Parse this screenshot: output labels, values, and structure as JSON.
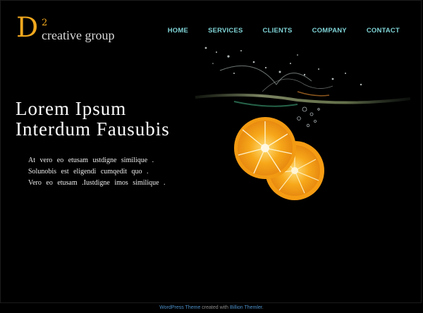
{
  "logo": {
    "letter": "D",
    "superscript": "2",
    "text": "creative group"
  },
  "nav": {
    "items": [
      {
        "label": "HOME"
      },
      {
        "label": "SERVICES"
      },
      {
        "label": "CLIENTS"
      },
      {
        "label": "COMPANY"
      },
      {
        "label": "CONTACT"
      }
    ]
  },
  "hero": {
    "headline_line1": "Lorem Ipsum",
    "headline_line2": "Interdum Fausubis",
    "body_lines": [
      "At vero  eo etusam  ustdigne  similique  .",
      "Solunobis  est eligendi  cumqedit  quo .",
      "Vero  eo etusam  .Iustdigne  imos  similique  ."
    ]
  },
  "footer": {
    "link1": "WordPress Theme",
    "middle": " created with ",
    "link2": "Billion Themler",
    "end": "."
  },
  "colors": {
    "background": "#000000",
    "accent_orange": "#f1a81e",
    "nav_text": "#7fd3d6",
    "footer_link": "#4b8fc6"
  }
}
